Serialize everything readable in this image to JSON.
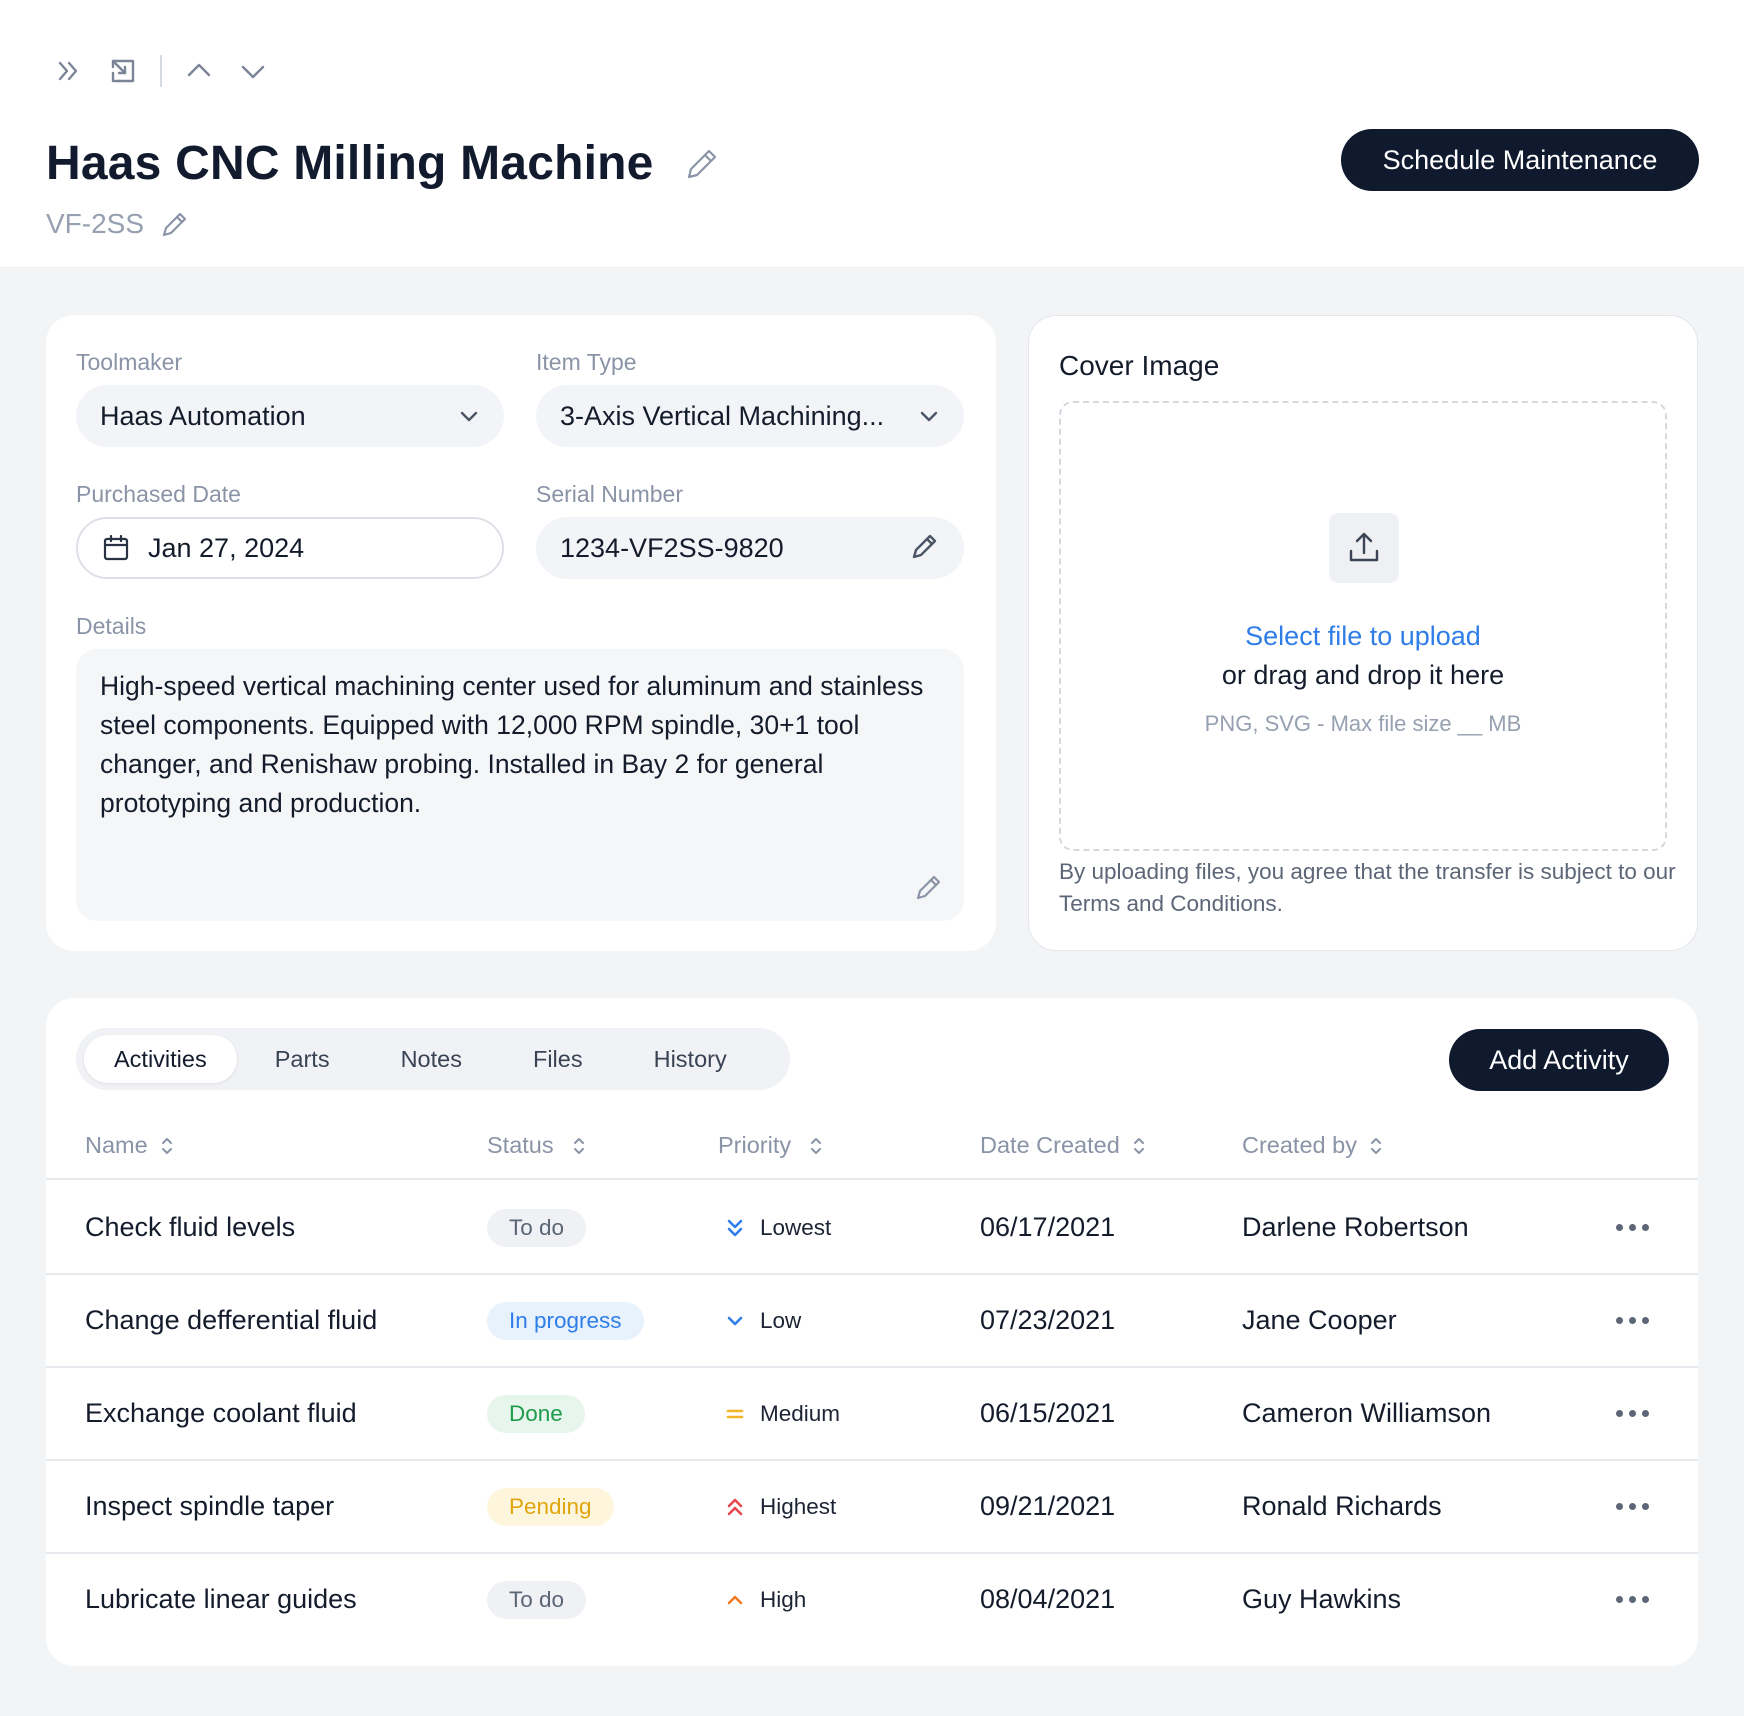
{
  "header": {
    "title": "Haas CNC Milling Machine",
    "subtitle": "VF-2SS",
    "schedule_button": "Schedule Maintenance",
    "nav_icons": [
      "double-chevron-right-icon",
      "collapse-icon",
      "chevron-up-icon",
      "chevron-down-icon"
    ]
  },
  "form": {
    "toolmaker": {
      "label": "Toolmaker",
      "value": "Haas Automation"
    },
    "item_type": {
      "label": "Item Type",
      "value": "3-Axis Vertical Machining..."
    },
    "purchased_date": {
      "label": "Purchased Date",
      "value": "Jan 27, 2024"
    },
    "serial_number": {
      "label": "Serial Number",
      "value": "1234-VF2SS-9820"
    },
    "details": {
      "label": "Details",
      "value": "High-speed vertical machining center used for aluminum and stainless steel components. Equipped with 12,000 RPM spindle, 30+1 tool changer, and Renishaw probing. Installed in Bay 2 for general prototyping and production."
    }
  },
  "cover": {
    "title": "Cover Image",
    "upload_link": "Select file to upload",
    "upload_drag": "or drag and drop it here",
    "upload_hint": "PNG, SVG - Max file size __ MB",
    "terms": "By uploading files, you agree that the transfer is subject to our Terms and Conditions."
  },
  "activities": {
    "tabs": [
      "Activities",
      "Parts",
      "Notes",
      "Files",
      "History"
    ],
    "active_tab": "Activities",
    "add_button": "Add Activity",
    "columns": [
      "Name",
      "Status",
      "Priority",
      "Date Created",
      "Created by"
    ],
    "rows": [
      {
        "name": "Check fluid levels",
        "status": "To do",
        "priority": "Lowest",
        "date": "06/17/2021",
        "created_by": "Darlene Robertson"
      },
      {
        "name": "Change defferential fluid",
        "status": "In progress",
        "priority": "Low",
        "date": "07/23/2021",
        "created_by": "Jane Cooper"
      },
      {
        "name": "Exchange coolant fluid",
        "status": "Done",
        "priority": "Medium",
        "date": "06/15/2021",
        "created_by": "Cameron Williamson"
      },
      {
        "name": "Inspect spindle taper",
        "status": "Pending",
        "priority": "Highest",
        "date": "09/21/2021",
        "created_by": "Ronald Richards"
      },
      {
        "name": "Lubricate linear guides",
        "status": "To do",
        "priority": "High",
        "date": "08/04/2021",
        "created_by": "Guy Hawkins"
      }
    ]
  },
  "colors": {
    "primary_dark": "#0f1a2e",
    "link_blue": "#2f7ee8",
    "status_todo": {
      "bg": "#eff1f4",
      "fg": "#5b6576"
    },
    "status_in_progress": {
      "bg": "#e8f2fd",
      "fg": "#2f7ee8"
    },
    "status_done": {
      "bg": "#e7f6ec",
      "fg": "#1f9a4a"
    },
    "status_pending": {
      "bg": "#fdf6dc",
      "fg": "#e0a60f"
    },
    "priority_lowest": "#2f7ee8",
    "priority_low": "#2f7ee8",
    "priority_medium": "#f2b52a",
    "priority_highest": "#e5484d",
    "priority_high": "#f07a24"
  }
}
